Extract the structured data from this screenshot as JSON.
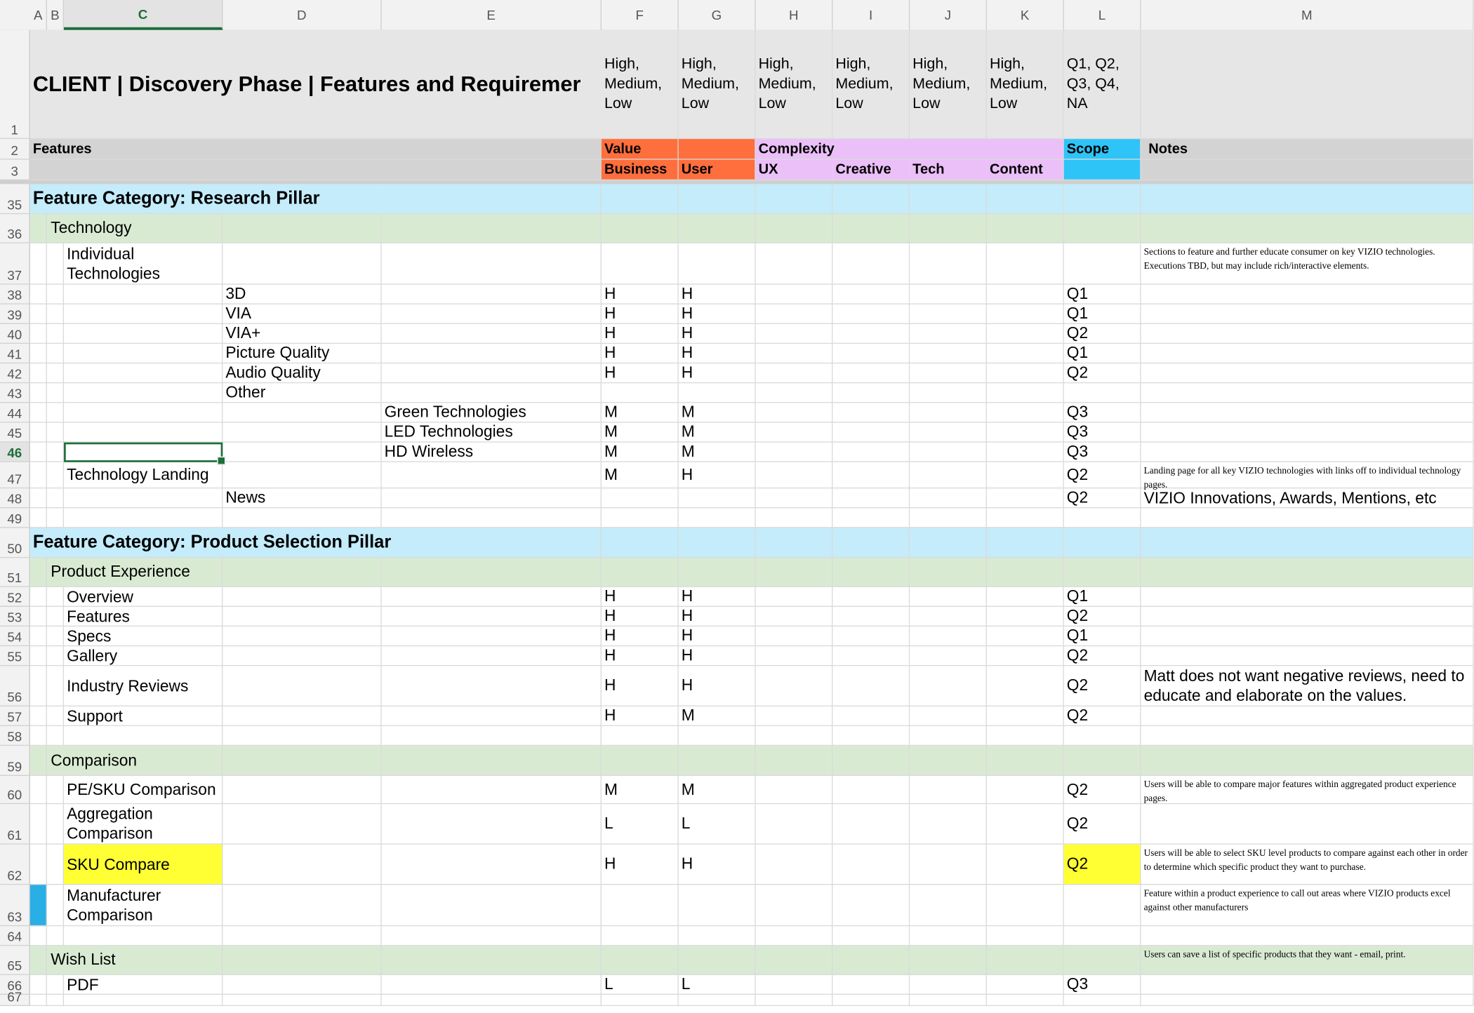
{
  "columns": [
    "A",
    "B",
    "C",
    "D",
    "E",
    "F",
    "G",
    "H",
    "I",
    "J",
    "K",
    "L",
    "M"
  ],
  "active_column": "C",
  "active_row": "46",
  "colors": {
    "header_gray": "#e6e6e6",
    "band_gray": "#d3d3d3",
    "value_orange": "#ff6e3d",
    "complexity_pink": "#ebc0f8",
    "scope_blue": "#2ec4f8",
    "category_blue": "#c4ecfb",
    "subcategory_green": "#d9ead3",
    "highlight_yellow": "#ffff33",
    "marker_blue": "#29aee6",
    "selection_green": "#1d6e3a"
  },
  "sheet": {
    "title": "CLIENT | Discovery Phase | Features and Requiremer",
    "rating_hml": "High, Medium, Low",
    "rating_scope": "Q1, Q2, Q3, Q4, NA",
    "features_label": "Features",
    "value_label": "Value",
    "complexity_label": "Complexity",
    "scope_label": "Scope",
    "notes_label": "Notes",
    "business_label": "Business",
    "user_label": "User",
    "ux_label": "UX",
    "creative_label": "Creative",
    "tech_label": "Tech",
    "content_label": "Content"
  },
  "rows": [
    {
      "n": "35",
      "kind": "category",
      "C": "Feature Category: Research Pillar"
    },
    {
      "n": "36",
      "kind": "subcategory",
      "B": "Technology"
    },
    {
      "n": "37",
      "kind": "item",
      "C": "Individual Technologies",
      "M": "Sections to feature and further educate consumer on key VIZIO technologies. Executions TBD, but may include rich/interactive elements."
    },
    {
      "n": "38",
      "kind": "item",
      "D": "3D",
      "F": "H",
      "G": "H",
      "L": "Q1"
    },
    {
      "n": "39",
      "kind": "item",
      "D": "VIA",
      "F": "H",
      "G": "H",
      "L": "Q1"
    },
    {
      "n": "40",
      "kind": "item",
      "D": "VIA+",
      "F": "H",
      "G": "H",
      "L": "Q2"
    },
    {
      "n": "41",
      "kind": "item",
      "D": "Picture Quality",
      "F": "H",
      "G": "H",
      "L": "Q1"
    },
    {
      "n": "42",
      "kind": "item",
      "D": "Audio Quality",
      "F": "H",
      "G": "H",
      "L": "Q2"
    },
    {
      "n": "43",
      "kind": "item",
      "D": "Other"
    },
    {
      "n": "44",
      "kind": "item",
      "E": "Green Technologies",
      "F": "M",
      "G": "M",
      "L": "Q3"
    },
    {
      "n": "45",
      "kind": "item",
      "E": "LED Technologies",
      "F": "M",
      "G": "M",
      "L": "Q3"
    },
    {
      "n": "46",
      "kind": "item",
      "E": "HD Wireless",
      "F": "M",
      "G": "M",
      "L": "Q3"
    },
    {
      "n": "47",
      "kind": "item",
      "C": "Technology Landing",
      "F": "M",
      "G": "H",
      "L": "Q2",
      "M": "Landing page for all key VIZIO technologies with links off to individual technology pages."
    },
    {
      "n": "48",
      "kind": "item",
      "D": "News",
      "L": "Q2",
      "M_big": "VIZIO Innovations, Awards, Mentions, etc"
    },
    {
      "n": "49",
      "kind": "blank"
    },
    {
      "n": "50",
      "kind": "category",
      "C": "Feature Category: Product Selection Pillar"
    },
    {
      "n": "51",
      "kind": "subcategory",
      "B": "Product Experience"
    },
    {
      "n": "52",
      "kind": "item",
      "C": "Overview",
      "F": "H",
      "G": "H",
      "L": "Q1"
    },
    {
      "n": "53",
      "kind": "item",
      "C": "Features",
      "F": "H",
      "G": "H",
      "L": "Q2"
    },
    {
      "n": "54",
      "kind": "item",
      "C": "Specs",
      "F": "H",
      "G": "H",
      "L": "Q1"
    },
    {
      "n": "55",
      "kind": "item",
      "C": "Gallery",
      "F": "H",
      "G": "H",
      "L": "Q2"
    },
    {
      "n": "56",
      "kind": "item",
      "C": "Industry Reviews",
      "F": "H",
      "G": "H",
      "L": "Q2",
      "M_big": "Matt does not want negative reviews, need to educate and elaborate on the values."
    },
    {
      "n": "57",
      "kind": "item",
      "C": "Support",
      "F": "H",
      "G": "M",
      "L": "Q2"
    },
    {
      "n": "58",
      "kind": "blank"
    },
    {
      "n": "59",
      "kind": "subcategory",
      "B": "Comparison"
    },
    {
      "n": "60",
      "kind": "item",
      "C": "PE/SKU Comparison",
      "F": "M",
      "G": "M",
      "L": "Q2",
      "M": "Users will be able to compare major features within aggregated product experience pages."
    },
    {
      "n": "61",
      "kind": "item",
      "C": "Aggregation Comparison",
      "F": "L",
      "G": "L",
      "L": "Q2"
    },
    {
      "n": "62",
      "kind": "item",
      "C": "SKU Compare",
      "F": "H",
      "G": "H",
      "L": "Q2",
      "highlight": true,
      "M": "Users will be able to select SKU level products to compare against each other in order to determine which specific product they want to purchase."
    },
    {
      "n": "63",
      "kind": "item",
      "C": "Manufacturer Comparison",
      "marker": true,
      "M": "Feature within a product experience to call out areas where VIZIO products excel against other manufacturers"
    },
    {
      "n": "64",
      "kind": "blank"
    },
    {
      "n": "65",
      "kind": "subcategory",
      "B": "Wish List",
      "M": "Users can save a list of specific products that they want - email, print."
    },
    {
      "n": "66",
      "kind": "item",
      "C": "PDF",
      "F": "L",
      "G": "L",
      "L": "Q3"
    },
    {
      "n": "67",
      "kind": "blank"
    }
  ]
}
